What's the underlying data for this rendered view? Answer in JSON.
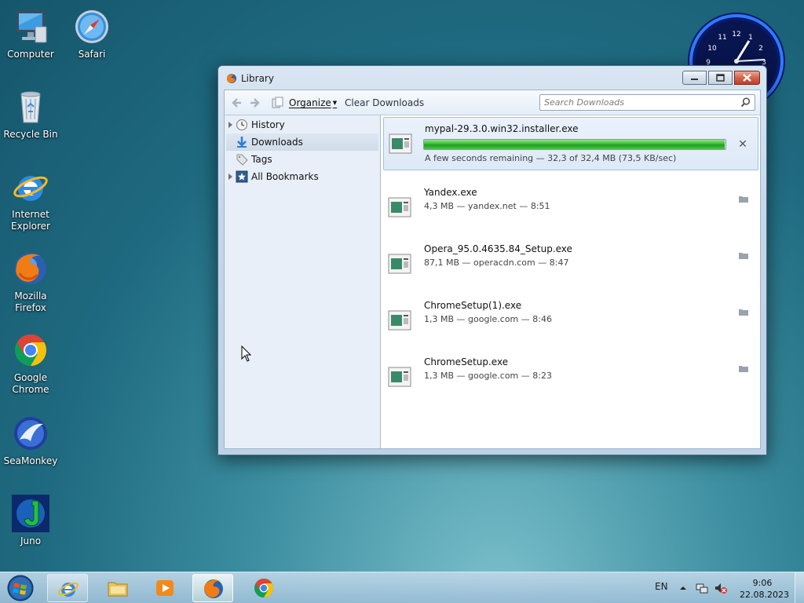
{
  "desktop": {
    "icons": [
      {
        "label": "Computer",
        "icon": "computer-icon"
      },
      {
        "label": "Safari",
        "icon": "safari-icon"
      },
      {
        "label": "Recycle Bin",
        "icon": "recycle-bin-icon"
      },
      {
        "label": "Internet Explorer",
        "icon": "internet-explorer-icon"
      },
      {
        "label": "Mozilla Firefox",
        "icon": "firefox-icon"
      },
      {
        "label": "Google Chrome",
        "icon": "chrome-icon"
      },
      {
        "label": "SeaMonkey",
        "icon": "seamonkey-icon"
      },
      {
        "label": "Juno",
        "icon": "juno-icon"
      }
    ],
    "clock_numbers": [
      "12",
      "1",
      "2",
      "3",
      "9",
      "10",
      "11"
    ]
  },
  "window": {
    "title": "Library",
    "toolbar": {
      "organize_label": "Organize",
      "clear_label": "Clear Downloads",
      "search_placeholder": "Search Downloads"
    },
    "sidebar": [
      {
        "label": "History",
        "icon": "history-clock-icon",
        "expandable": true
      },
      {
        "label": "Downloads",
        "icon": "download-arrow-icon",
        "expandable": false,
        "selected": true
      },
      {
        "label": "Tags",
        "icon": "tag-icon",
        "expandable": false
      },
      {
        "label": "All Bookmarks",
        "icon": "bookmarks-star-icon",
        "expandable": true
      }
    ],
    "downloads": [
      {
        "name": "mypal-29.3.0.win32.installer.exe",
        "status": "A few seconds remaining — 32,3 of 32,4 MB (73,5 KB/sec)",
        "progress": 0.997,
        "active": true
      },
      {
        "name": "Yandex.exe",
        "status": "4,3 MB — yandex.net — 8:51"
      },
      {
        "name": "Opera_95.0.4635.84_Setup.exe",
        "status": "87,1 MB — operacdn.com — 8:47"
      },
      {
        "name": "ChromeSetup(1).exe",
        "status": "1,3 MB — google.com — 8:46"
      },
      {
        "name": "ChromeSetup.exe",
        "status": "1,3 MB — google.com — 8:23"
      }
    ]
  },
  "taskbar": {
    "language": "EN",
    "time": "9:06",
    "date": "22.08.2023",
    "buttons": [
      "start-orb-icon",
      "internet-explorer-icon",
      "explorer-folder-icon",
      "media-player-icon",
      "firefox-icon",
      "chrome-icon"
    ]
  },
  "colors": {
    "progress_green": "#38b936",
    "selection_blue": "#dde9f7"
  }
}
